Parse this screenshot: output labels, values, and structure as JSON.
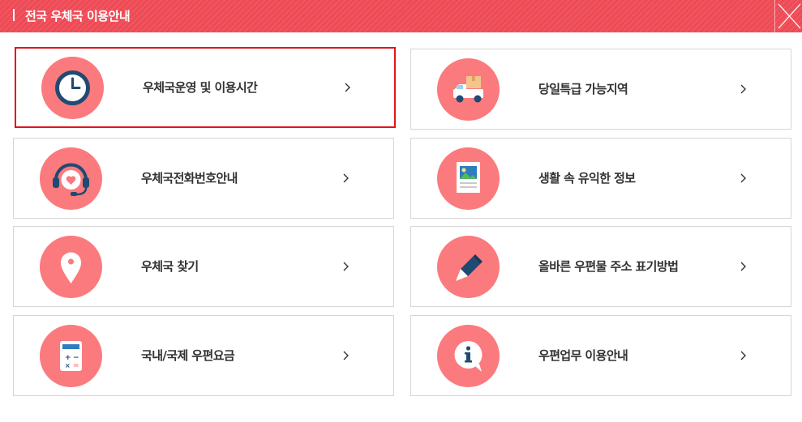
{
  "header": {
    "title": "전국 우체국 이용안내",
    "background_color": "#ee4a55",
    "close_icon": "close-icon"
  },
  "accent_colors": {
    "icon_circle": "#fb7a7d",
    "selected_border": "#e1141b",
    "icon_dark": "#1f4a73"
  },
  "menu": {
    "items": [
      {
        "label": "우체국운영 및 이용시간",
        "icon": "clock-icon",
        "selected": true
      },
      {
        "label": "당일특급 가능지역",
        "icon": "delivery-truck-icon",
        "selected": false
      },
      {
        "label": "우체국전화번호안내",
        "icon": "headset-icon",
        "selected": false
      },
      {
        "label": "생활 속 유익한 정보",
        "icon": "picture-document-icon",
        "selected": false
      },
      {
        "label": "우체국 찾기",
        "icon": "location-pin-icon",
        "selected": false
      },
      {
        "label": "올바른 우편물 주소 표기방법",
        "icon": "pencil-icon",
        "selected": false
      },
      {
        "label": "국내/국제 우편요금",
        "icon": "calculator-icon",
        "selected": false
      },
      {
        "label": "우편업무 이용안내",
        "icon": "info-bubble-icon",
        "selected": false
      }
    ],
    "arrow_icon": "chevron-right-icon"
  }
}
